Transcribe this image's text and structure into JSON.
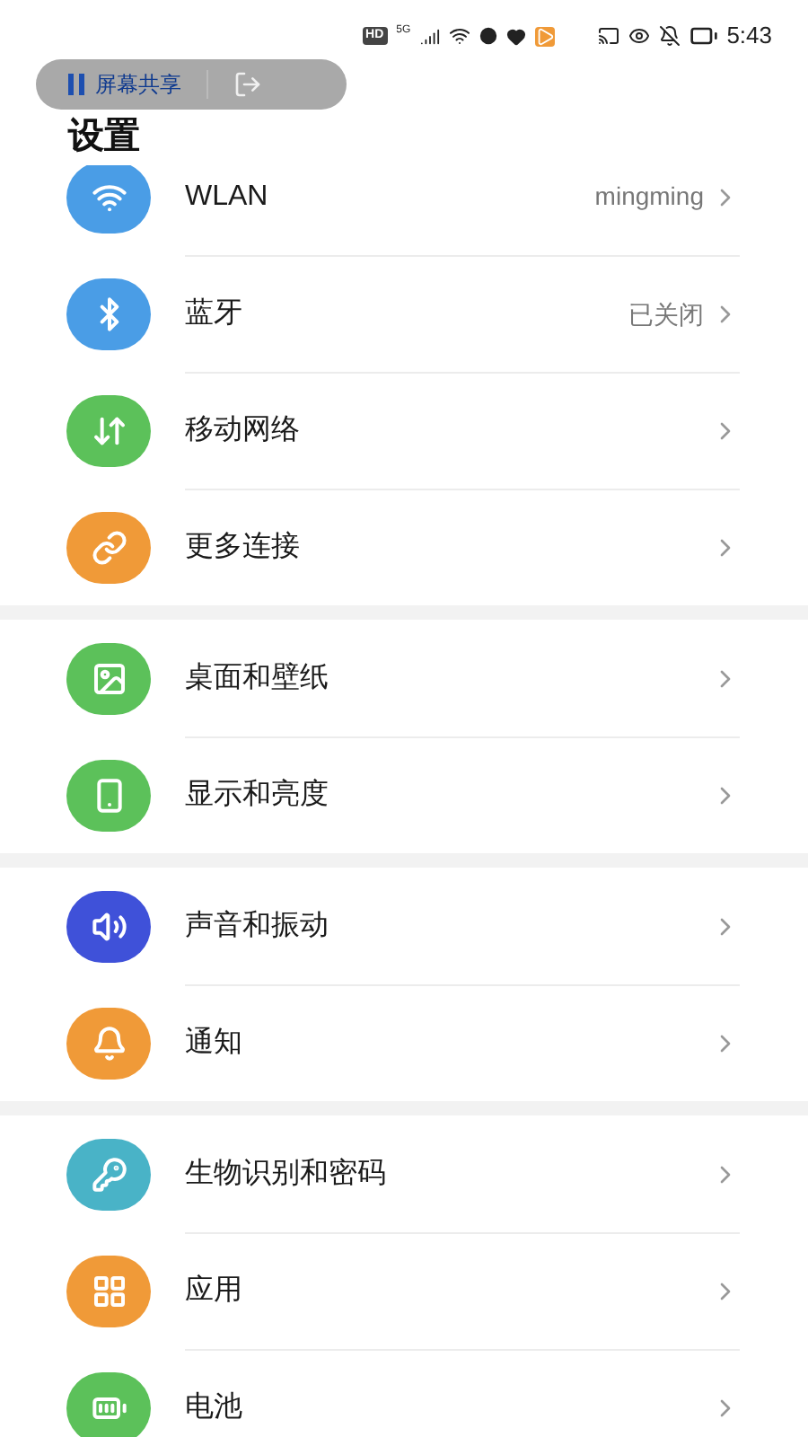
{
  "status_bar": {
    "hd": "HD",
    "network": "5G",
    "time": "5:43"
  },
  "share_pill": {
    "label": "屏幕共享"
  },
  "title": "设置",
  "groups": [
    {
      "items": [
        {
          "label": "WLAN",
          "value": "mingming",
          "color": "#4a9de6"
        },
        {
          "label": "蓝牙",
          "value": "已关闭",
          "color": "#4a9de6"
        },
        {
          "label": "移动网络",
          "color": "#5cc15a"
        },
        {
          "label": "更多连接",
          "color": "#f09a38"
        }
      ]
    },
    {
      "items": [
        {
          "label": "桌面和壁纸",
          "color": "#5cc15a"
        },
        {
          "label": "显示和亮度",
          "color": "#5cc15a"
        }
      ]
    },
    {
      "items": [
        {
          "label": "声音和振动",
          "color": "#3f51d9"
        },
        {
          "label": "通知",
          "color": "#f09a38"
        }
      ]
    },
    {
      "items": [
        {
          "label": "生物识别和密码",
          "color": "#49b3c7"
        },
        {
          "label": "应用",
          "color": "#f09a38"
        },
        {
          "label": "电池",
          "color": "#5cc15a"
        }
      ]
    }
  ]
}
